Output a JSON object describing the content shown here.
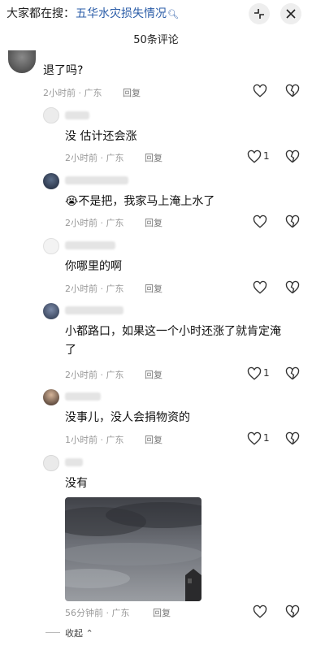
{
  "search": {
    "prefix": "大家都在搜：",
    "topic": "五华水灾损失情况"
  },
  "header": {
    "comment_count": "50条评论"
  },
  "comments": [
    {
      "text": "退了吗?",
      "time": "2小时前 · 广东",
      "reply": "回复"
    },
    {
      "text": "没  估计还会涨",
      "time": "2小时前 · 广东",
      "reply": "回复",
      "likes": "1"
    },
    {
      "emoji": "😭",
      "text": "不是把，我家马上淹上水了",
      "time": "2小时前 · 广东",
      "reply": "回复"
    },
    {
      "text": "你哪里的啊",
      "time": "2小时前 · 广东",
      "reply": "回复"
    },
    {
      "text_line1": "小都路口，如果这一个小时还涨了就肯定淹",
      "text_line2": "了",
      "time": "2小时前 · 广东",
      "reply": "回复",
      "likes": "1"
    },
    {
      "text": "没事儿，没人会捐物资的",
      "time": "1小时前 · 广东",
      "reply": "回复",
      "likes": "1"
    },
    {
      "text": "没有",
      "time": "56分钟前 · 广东",
      "reply": "回复"
    }
  ],
  "footer": {
    "collapse": "收起"
  },
  "icons": {
    "like": "heart-icon",
    "dislike": "broken-heart-icon",
    "expand": "collapse-arrows-icon",
    "close": "close-icon"
  }
}
